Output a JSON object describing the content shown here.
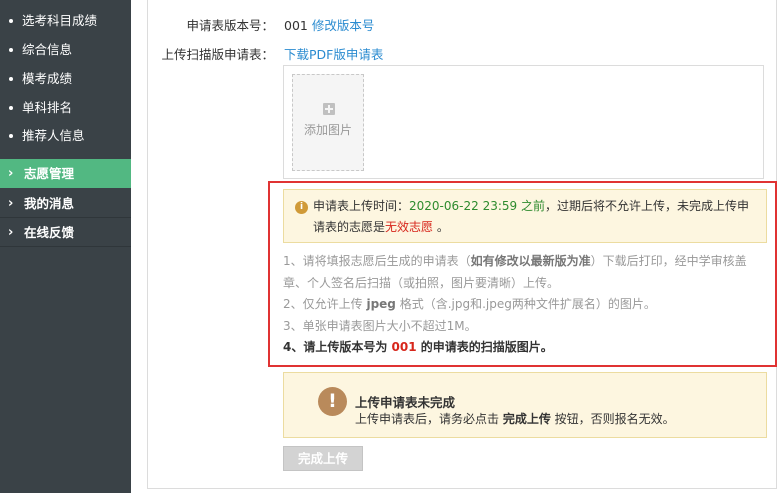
{
  "sidebar": {
    "sub_items": [
      {
        "label": "选考科目成绩"
      },
      {
        "label": "综合信息"
      },
      {
        "label": "模考成绩"
      },
      {
        "label": "单科排名"
      },
      {
        "label": "推荐人信息"
      }
    ],
    "main_items": [
      {
        "label": "志愿管理",
        "active": true
      },
      {
        "label": "我的消息",
        "active": false
      },
      {
        "label": "在线反馈",
        "active": false
      }
    ],
    "colors": {
      "background": "#3a4247",
      "active": "#52b882"
    }
  },
  "form": {
    "version_label": "申请表版本号：",
    "version_value": "001",
    "modify_link": "修改版本号",
    "upload_label": "上传扫描版申请表：",
    "download_link": "下载PDF版申请表",
    "add_image_label": "添加图片"
  },
  "deadline": {
    "icon": "info-icon",
    "prefix": "申请表上传时间：",
    "datetime": "2020-06-22 23:59 之前",
    "middle": "，过期后将不允许上传，未完成上传申请表的志愿是",
    "invalid": "无效志愿",
    "suffix": " 。"
  },
  "notes": {
    "n1_a": "1、请将填报志愿后生成的申请表（",
    "n1_b": "如有修改以最新版为准",
    "n1_c": "）下载后打印，经中学审核盖章、个人签名后扫描（或拍照，图片要清晰）上传。",
    "n2_a": "2、仅允许上传 ",
    "n2_b": "jpeg",
    "n2_c": " 格式（含.jpg和.jpeg两种文件扩展名）的图片。",
    "n3": "3、单张申请表图片大小不超过1M。",
    "n4_a": "4、请上传版本号为 ",
    "n4_b": "001",
    "n4_c": " 的申请表的扫描版图片。"
  },
  "warning": {
    "icon": "exclamation-icon",
    "title": "上传申请表未完成",
    "desc_a": "上传申请表后，请务必点击 ",
    "desc_b": "完成上传",
    "desc_c": " 按钮，否则报名无效。"
  },
  "finish_button": "完成上传"
}
